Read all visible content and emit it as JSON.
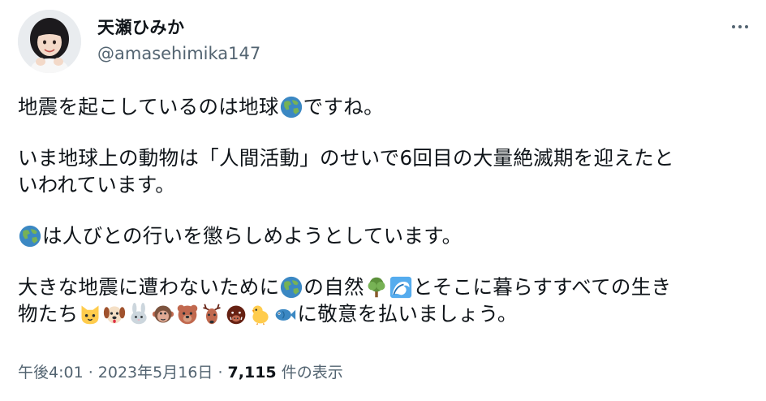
{
  "user": {
    "display_name": "天瀬ひみか",
    "handle": "@amasehimika147"
  },
  "tweet": {
    "p1": {
      "a": "地震を起こしているのは地球",
      "b": "ですね。"
    },
    "p2": {
      "l1": "いま地球上の動物は「人間活動」のせいで6回目の大量絶滅期を迎えたと",
      "l2": "いわれています。"
    },
    "p3": {
      "a": "は人びとの行いを懲らしめようとしています。"
    },
    "p4": {
      "l1a": "大きな地震に遭わないために",
      "l1b": "の自然",
      "l1c": "とそこに暮らすすべての生き",
      "l2a": "物たち",
      "l2b": "に敬意を払いましょう。"
    }
  },
  "emojis": {
    "earth": "earth-globe-asia-icon",
    "tree": "deciduous-tree-icon",
    "wave": "water-wave-icon",
    "animals": [
      "cat-face-icon",
      "dog-face-icon",
      "rabbit-face-icon",
      "monkey-face-icon",
      "bear-face-icon",
      "deer-icon",
      "boar-face-icon",
      "baby-chick-icon",
      "fish-icon"
    ]
  },
  "meta": {
    "time": "午後4:01",
    "sep1": " · ",
    "date": "2023年5月16日",
    "sep2": " · ",
    "views": "7,115",
    "views_label": " 件の表示"
  },
  "colors": {
    "text": "#0f1419",
    "secondary": "#536471",
    "background": "#ffffff"
  }
}
